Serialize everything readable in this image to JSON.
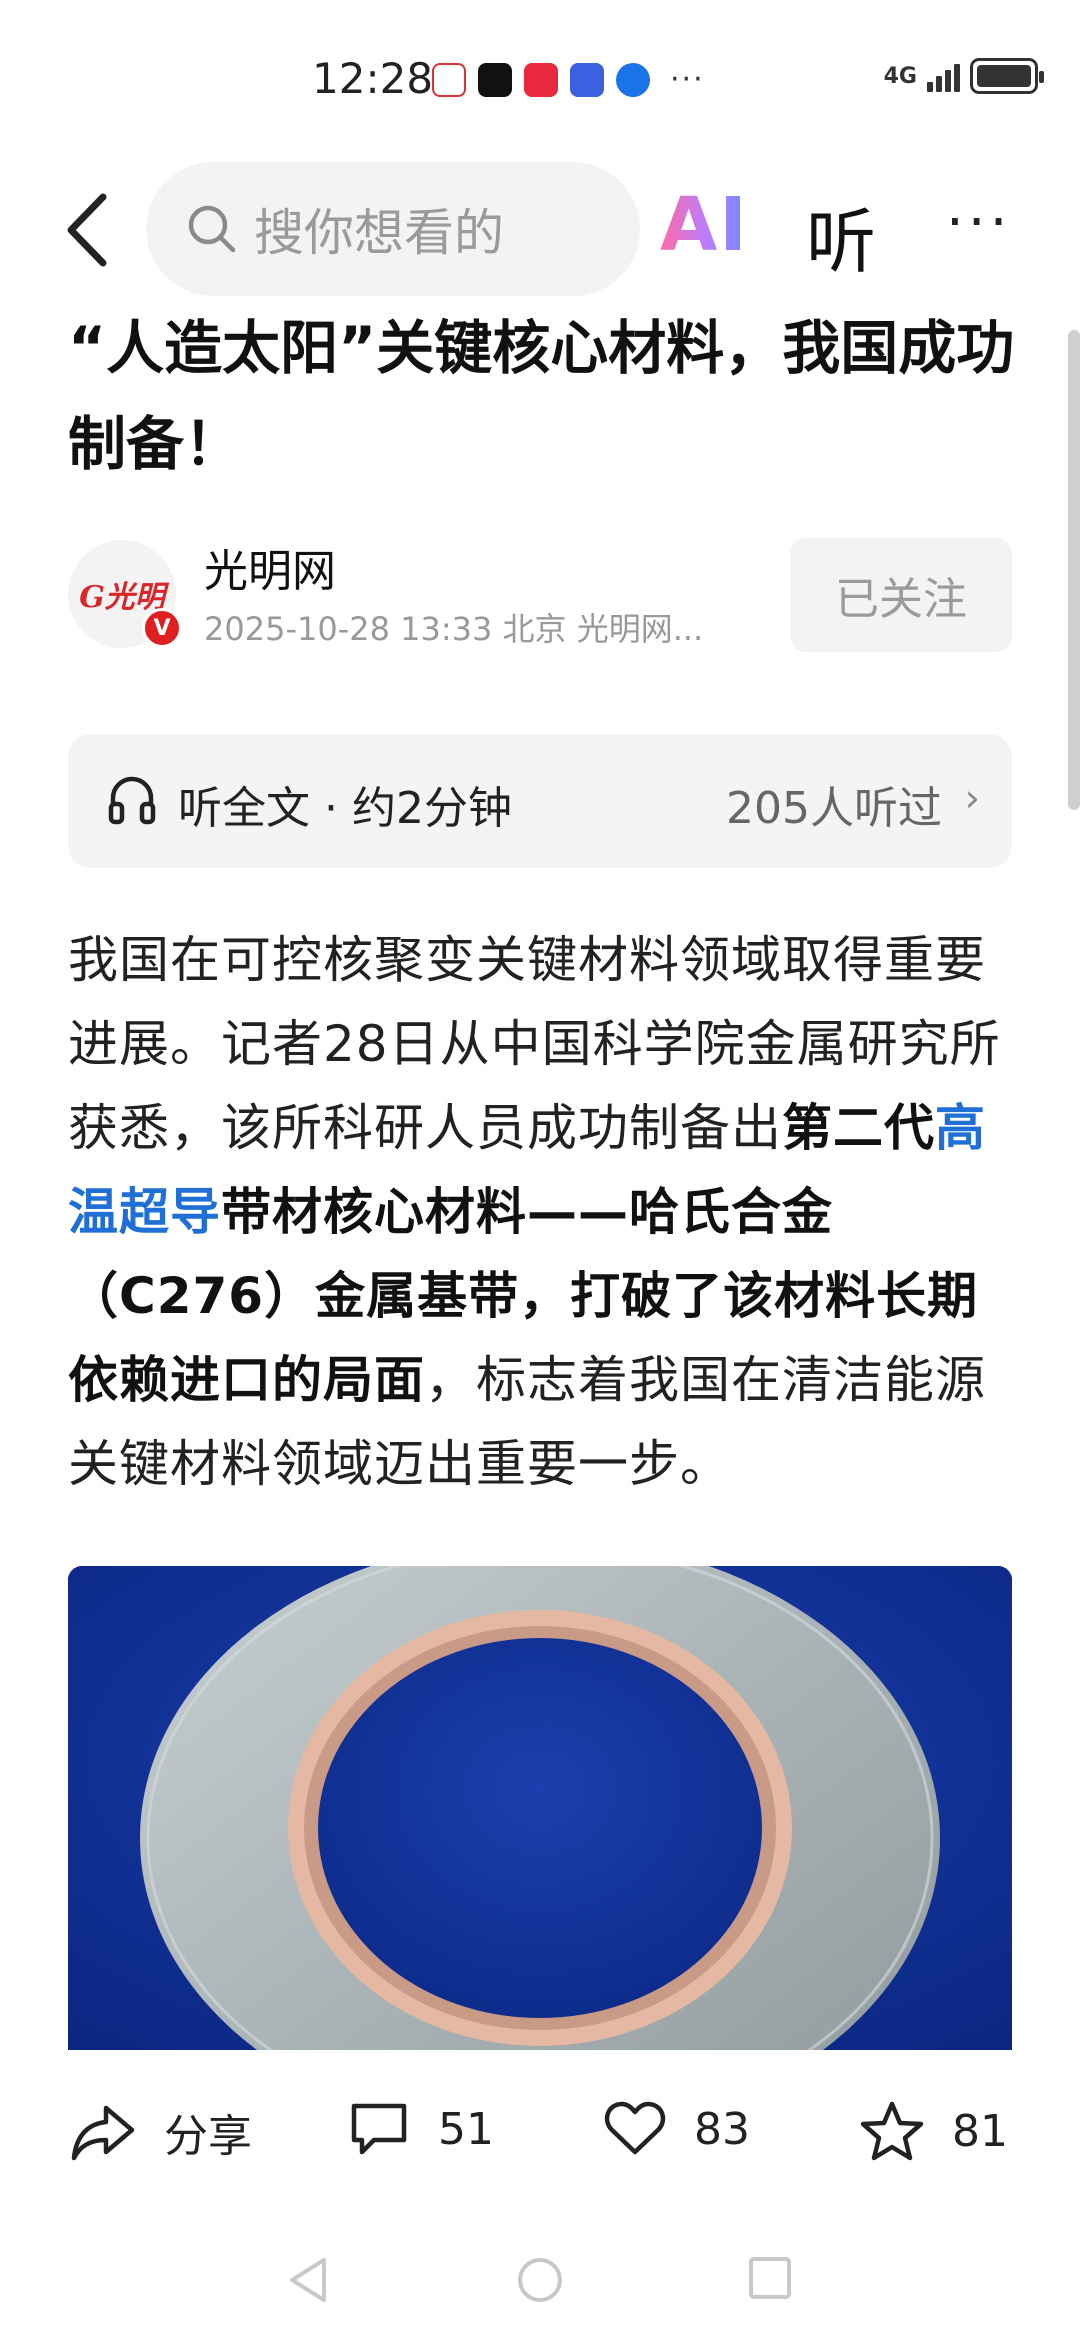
{
  "status_bar": {
    "time": "12:28",
    "network": "4G",
    "more": "···",
    "app_icons": [
      "news-app-icon",
      "tiktok-icon",
      "shopping-app-icon",
      "baidu-icon",
      "browser-app-icon"
    ]
  },
  "nav": {
    "search_placeholder": "搜你想看的",
    "ai_label": "AI",
    "listen_label": "听",
    "more_label": "···"
  },
  "article": {
    "title": "“人造太阳”关键核心材料，我国成功制备！",
    "author": {
      "name": "光明网",
      "meta": "2025-10-28  13:33  北京  光明网...",
      "follow_label": "已关注"
    },
    "listen": {
      "label": "听全文 · 约2分钟",
      "count": "205人听过"
    },
    "body": {
      "p1": "我国在可控核聚变关键材料领域取得重要进展。记者28日从中国科学院金属研究所获悉，该所科研人员成功制备出",
      "bold1": "第二代",
      "link": "高温超导",
      "bold2": "带材核心材料——哈氏合金（C276）金属基带，打破了该材料长期依赖进口的局面",
      "p2": "，标志着我国在清洁能源关键材料领域迈出重要一步。"
    }
  },
  "actions": {
    "share_label": "分享",
    "comments": "51",
    "likes": "83",
    "favorites": "81"
  },
  "colors": {
    "link": "#1f6fd6",
    "image_bg": "#0c2e94",
    "badge": "#e02020"
  }
}
